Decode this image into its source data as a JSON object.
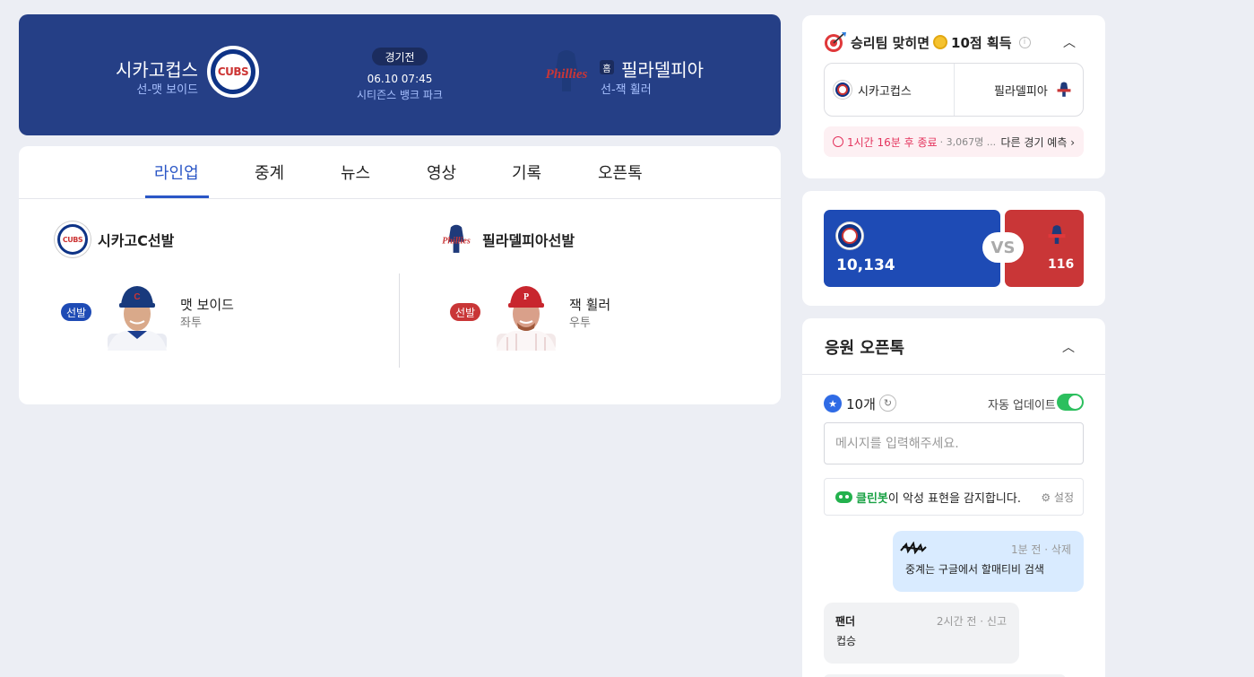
{
  "header": {
    "home_team": "시카고컵스",
    "home_pitcher": "선-맷 보이드",
    "status": "경기전",
    "datetime": "06.10 07:45",
    "stadium": "시티즌스 뱅크 파크",
    "home_tag": "홈",
    "away_team": "필라델피아",
    "away_pitcher": "선-잭 휠러",
    "cubs_logo_text": "CUBS",
    "phillies_logo_text": "Phillies"
  },
  "tabs": [
    {
      "label": "라인업",
      "active": true
    },
    {
      "label": "중계"
    },
    {
      "label": "뉴스"
    },
    {
      "label": "영상"
    },
    {
      "label": "기록"
    },
    {
      "label": "오픈톡"
    }
  ],
  "lineup": {
    "left": {
      "title": "시카고C선발",
      "badge": "선발",
      "player_name": "맷 보이드",
      "hand": "좌투",
      "badge_color": "#1e4bb5"
    },
    "right": {
      "title": "필라델피아선발",
      "badge": "선발",
      "player_name": "잭 휠러",
      "hand": "우투",
      "badge_color": "#c93637"
    }
  },
  "predict": {
    "title_pre": "승리팀 맞히면",
    "title_post": "10점 획득",
    "info": "i",
    "pick_home": "시카고컵스",
    "pick_away": "필라델피아",
    "time_left": "1시간 16분 후 종료",
    "participants": "· 3,067명 ...",
    "other_link": "다른 경기 예측 ›"
  },
  "vote": {
    "home_count": "10,134",
    "away_count": "116",
    "vs": "VS"
  },
  "talk": {
    "title": "응원 오픈톡",
    "count": "10개",
    "auto_update": "자동 업데이트",
    "auto_update_on": true,
    "input_placeholder": "메시지를 입력해주세요.",
    "cleanbot_name": "클린봇",
    "cleanbot_text": "이 악성 표현을 감지합니다.",
    "cleanbot_settings": "설정",
    "messages": [
      {
        "meta": "1분 전 · 삭제",
        "text": "중계는 구글에서 할매티비 검색"
      },
      {
        "author": "팬더",
        "meta": "2시간 전 · 신고",
        "text": "컵승"
      }
    ]
  },
  "icons": {
    "refresh": "↻",
    "people": "★",
    "collapse": "︿"
  },
  "colors": {
    "header_bg": "#253f86",
    "accent": "#2a56c6",
    "cubs_blue": "#0e3386",
    "phillies_red": "#c93637",
    "toggle_on": "#2cbf5e"
  }
}
